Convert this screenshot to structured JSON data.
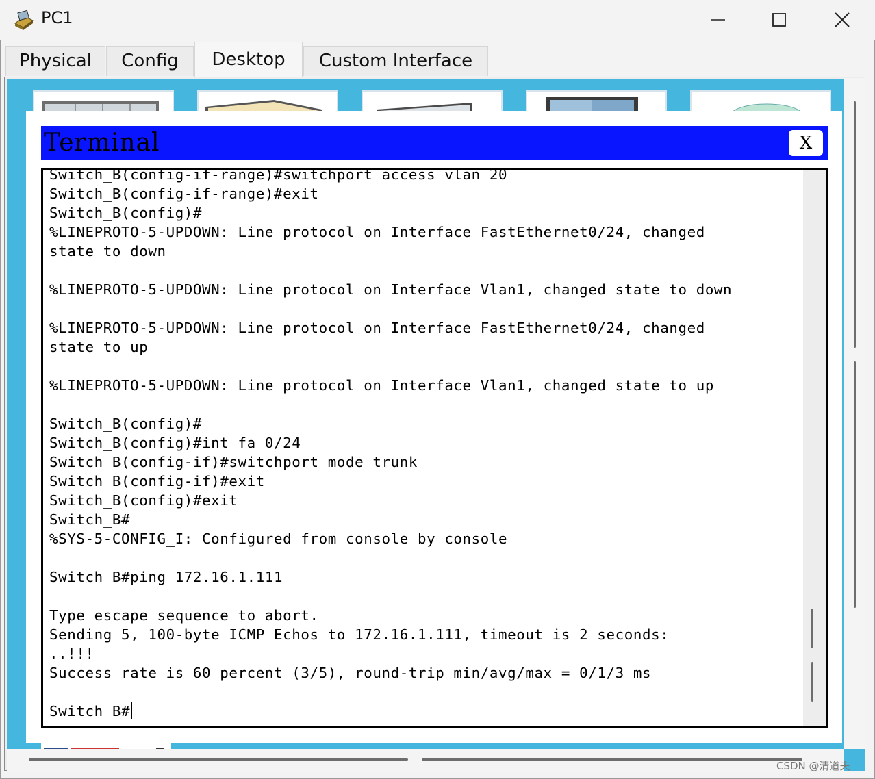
{
  "window": {
    "title": "PC1",
    "controls": {
      "minimize": "minimize-icon",
      "maximize": "maximize-icon",
      "close": "close-icon"
    }
  },
  "tabs": [
    {
      "label": "Physical",
      "active": false
    },
    {
      "label": "Config",
      "active": false
    },
    {
      "label": "Desktop",
      "active": true
    },
    {
      "label": "Custom Interface",
      "active": false
    }
  ],
  "terminal": {
    "title": "Terminal",
    "close_label": "X",
    "lines": [
      "Switch_B(config-if-range)#switchport access vlan 20",
      "Switch_B(config-if-range)#exit",
      "Switch_B(config)#",
      "%LINEPROTO-5-UPDOWN: Line protocol on Interface FastEthernet0/24, changed",
      "state to down",
      "",
      "%LINEPROTO-5-UPDOWN: Line protocol on Interface Vlan1, changed state to down",
      "",
      "%LINEPROTO-5-UPDOWN: Line protocol on Interface FastEthernet0/24, changed",
      "state to up",
      "",
      "%LINEPROTO-5-UPDOWN: Line protocol on Interface Vlan1, changed state to up",
      "",
      "Switch_B(config)#",
      "Switch_B(config)#int fa 0/24",
      "Switch_B(config-if)#switchport mode trunk",
      "Switch_B(config-if)#exit",
      "Switch_B(config)#exit",
      "Switch_B#",
      "%SYS-5-CONFIG_I: Configured from console by console",
      "",
      "Switch_B#ping 172.16.1.111",
      "",
      "Type escape sequence to abort.",
      "Sending 5, 100-byte ICMP Echos to 172.16.1.111, timeout is 2 seconds:",
      "..!!!",
      "Success rate is 60 percent (3/5), round-trip min/avg/max = 0/1/3 ms",
      ""
    ],
    "prompt": "Switch_B#"
  },
  "watermark": "CSDN @清道夫",
  "colors": {
    "terminal_header": "#0a15ff",
    "desktop_background": "#45b6dd"
  }
}
